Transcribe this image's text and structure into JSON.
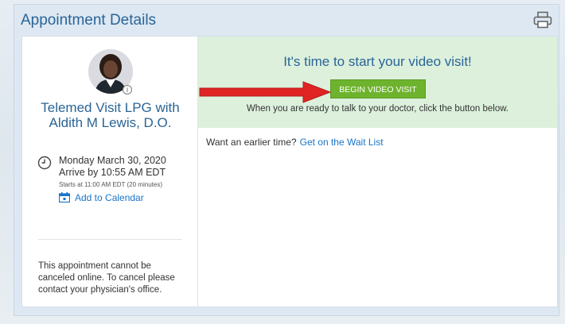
{
  "header": {
    "title": "Appointment Details",
    "print_icon": "printer-icon"
  },
  "provider": {
    "visit_name": "Telemed Visit LPG with Aldith M Lewis, D.O.",
    "avatar_icon": "provider-avatar",
    "info_icon_glyph": "i"
  },
  "schedule": {
    "date": "Monday March 30, 2020",
    "arrive": "Arrive by 10:55 AM EDT",
    "starts": "Starts at 11:00 AM EDT (20 minutes)",
    "add_to_calendar": "Add to Calendar"
  },
  "cancel_note": "This appointment cannot be canceled online. To cancel please contact your physician's office.",
  "video": {
    "heading": "It's time to start your video visit!",
    "button_label": "BEGIN VIDEO VISIT",
    "help_text": "When you are ready to talk to your doctor, click the button below."
  },
  "waitlist": {
    "prompt": "Want an earlier time?",
    "link": "Get on the Wait List"
  },
  "colors": {
    "accent": "#2a6496",
    "link": "#1a74c8",
    "button": "#6eb32d",
    "banner": "#dcf0dc",
    "arrow": "#e02424"
  }
}
